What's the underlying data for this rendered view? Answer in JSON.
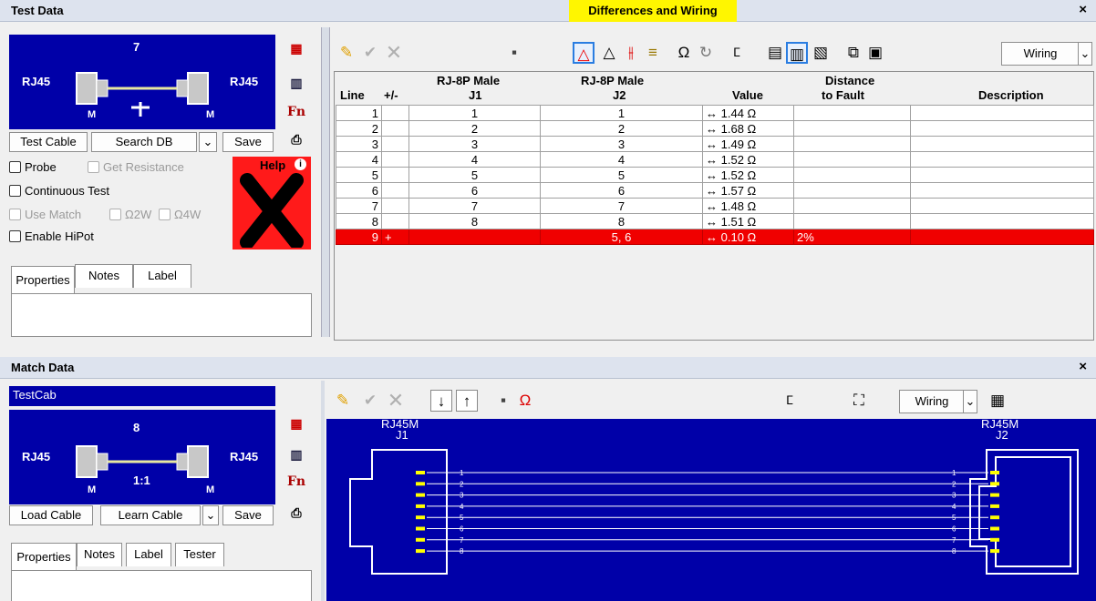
{
  "test_panel": {
    "title": "Test Data",
    "diff_badge": "Differences and Wiring",
    "close": "×",
    "cable": {
      "number": "7",
      "left_conn": "RJ45",
      "right_conn": "RJ45",
      "left_gender": "M",
      "right_gender": "M"
    },
    "buttons": {
      "test_cable": "Test Cable",
      "search_db": "Search DB",
      "save": "Save"
    },
    "checks": {
      "probe": "Probe",
      "get_resistance": "Get Resistance",
      "continuous": "Continuous Test",
      "use_match": "Use Match",
      "o2w": "Ω2W",
      "o4w": "Ω4W",
      "hipot": "Enable HiPot"
    },
    "help": "Help",
    "tabs": [
      "Properties",
      "Notes",
      "Label"
    ]
  },
  "wiring_table": {
    "dropdown": "Wiring",
    "headers": {
      "line": "Line",
      "pm": "+/-",
      "j1_a": "RJ-8P Male",
      "j1_b": "J1",
      "j2_a": "RJ-8P Male",
      "j2_b": "J2",
      "value": "Value",
      "dist_a": "Distance",
      "dist_b": "to Fault",
      "desc": "Description"
    },
    "rows": [
      {
        "line": "1",
        "pm": "",
        "j1": "1",
        "j2": "1",
        "value": "1.44 Ω",
        "dist": "",
        "desc": ""
      },
      {
        "line": "2",
        "pm": "",
        "j1": "2",
        "j2": "2",
        "value": "1.68 Ω",
        "dist": "",
        "desc": ""
      },
      {
        "line": "3",
        "pm": "",
        "j1": "3",
        "j2": "3",
        "value": "1.49 Ω",
        "dist": "",
        "desc": ""
      },
      {
        "line": "4",
        "pm": "",
        "j1": "4",
        "j2": "4",
        "value": "1.52 Ω",
        "dist": "",
        "desc": ""
      },
      {
        "line": "5",
        "pm": "",
        "j1": "5",
        "j2": "5",
        "value": "1.52 Ω",
        "dist": "",
        "desc": ""
      },
      {
        "line": "6",
        "pm": "",
        "j1": "6",
        "j2": "6",
        "value": "1.57 Ω",
        "dist": "",
        "desc": ""
      },
      {
        "line": "7",
        "pm": "",
        "j1": "7",
        "j2": "7",
        "value": "1.48 Ω",
        "dist": "",
        "desc": ""
      },
      {
        "line": "8",
        "pm": "",
        "j1": "8",
        "j2": "8",
        "value": "1.51 Ω",
        "dist": "",
        "desc": ""
      },
      {
        "line": "9",
        "pm": "+",
        "j1": "",
        "j2": "5, 6",
        "value": "0.10 Ω",
        "dist": "2%",
        "desc": "",
        "fault": true
      }
    ]
  },
  "match_panel": {
    "title": "Match Data",
    "close": "×",
    "cable_name": "TestCab",
    "cable": {
      "number": "8",
      "left_conn": "RJ45",
      "right_conn": "RJ45",
      "left_gender": "M",
      "right_gender": "M",
      "ratio": "1:1"
    },
    "buttons": {
      "load_cable": "Load Cable",
      "learn_cable": "Learn Cable",
      "save": "Save"
    },
    "tabs": [
      "Properties",
      "Notes",
      "Label",
      "Tester"
    ],
    "dropdown": "Wiring"
  },
  "wiring_diagram": {
    "left_label_a": "RJ45M",
    "left_label_b": "J1",
    "right_label_a": "RJ45M",
    "right_label_b": "J2",
    "wires": [
      "1",
      "2",
      "3",
      "4",
      "5",
      "6",
      "7",
      "8"
    ]
  },
  "colors": {
    "panel_blue": "#0000a8",
    "fault_red": "#f00000",
    "badge_yellow": "#fff600",
    "pin_yellow": "#ffff00"
  }
}
